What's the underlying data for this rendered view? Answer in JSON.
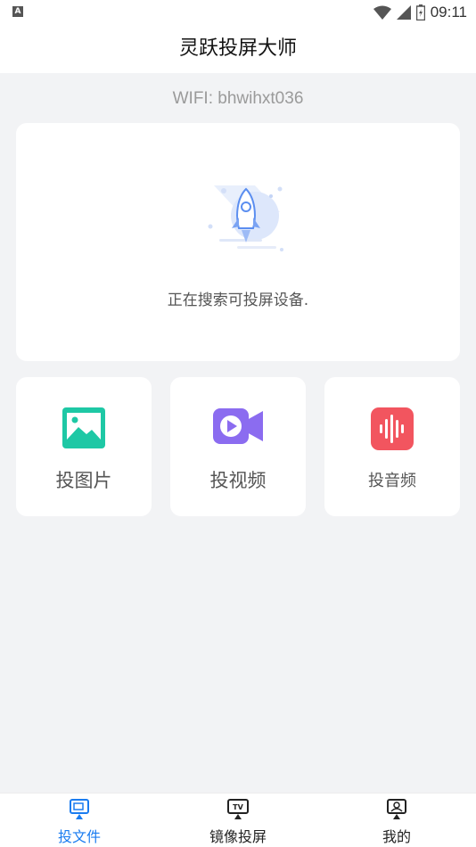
{
  "status_bar": {
    "time": "09:11",
    "notification_icon": "A"
  },
  "header": {
    "title": "灵跃投屏大师"
  },
  "wifi": {
    "label": "WIFI: bhwihxt036"
  },
  "search": {
    "status_text": "正在搜索可投屏设备."
  },
  "features": [
    {
      "label": "投图片",
      "icon": "image-icon",
      "color": "#1ec8a5"
    },
    {
      "label": "投视频",
      "icon": "video-icon",
      "color": "#8b6cf0"
    },
    {
      "label": "投音频",
      "icon": "audio-icon",
      "color": "#f2555f"
    }
  ],
  "tabs": [
    {
      "label": "投文件",
      "icon": "cast-file-icon",
      "active": true
    },
    {
      "label": "镜像投屏",
      "icon": "tv-icon",
      "active": false
    },
    {
      "label": "我的",
      "icon": "profile-icon",
      "active": false
    }
  ],
  "colors": {
    "accent": "#1a7cf0",
    "background": "#f2f3f5"
  }
}
